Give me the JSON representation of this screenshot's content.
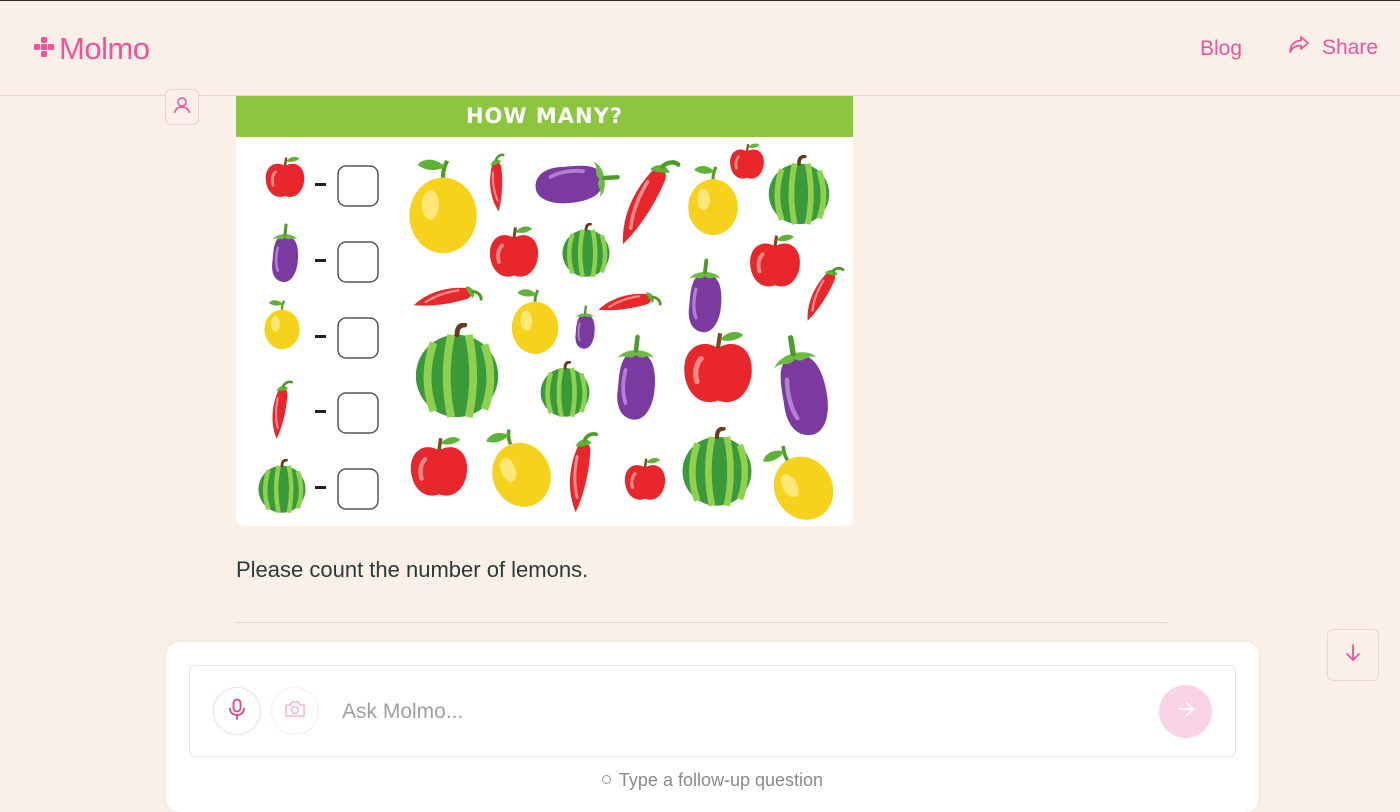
{
  "app": {
    "logo_text": "Molmo",
    "brand_color": "#f0529c"
  },
  "nav": {
    "blog_label": "Blog",
    "share_label": "Share"
  },
  "message": {
    "image": {
      "banner_text": "HOW MANY?",
      "legend_items": [
        "apple",
        "eggplant",
        "lemon",
        "chili-pepper",
        "watermelon"
      ],
      "scene_items": [
        "lemon",
        "chili-pepper",
        "eggplant",
        "chili-pepper",
        "lemon",
        "apple",
        "watermelon",
        "apple",
        "watermelon",
        "apple",
        "chili-pepper",
        "chili-pepper",
        "lemon",
        "eggplant",
        "chili-pepper",
        "eggplant",
        "watermelon",
        "watermelon",
        "eggplant",
        "apple",
        "eggplant",
        "apple",
        "lemon",
        "chili-pepper",
        "apple",
        "watermelon",
        "lemon"
      ]
    },
    "text": "Please count the number of lemons."
  },
  "composer": {
    "placeholder": "Ask Molmo...",
    "value": "",
    "hint": "Type a follow-up question"
  },
  "icons": {
    "logo": "molmo-logo-icon",
    "share": "share-arrow-icon",
    "avatar": "user-icon",
    "mic": "microphone-icon",
    "camera": "camera-icon",
    "send": "arrow-right-icon",
    "scroll": "arrow-down-icon"
  }
}
